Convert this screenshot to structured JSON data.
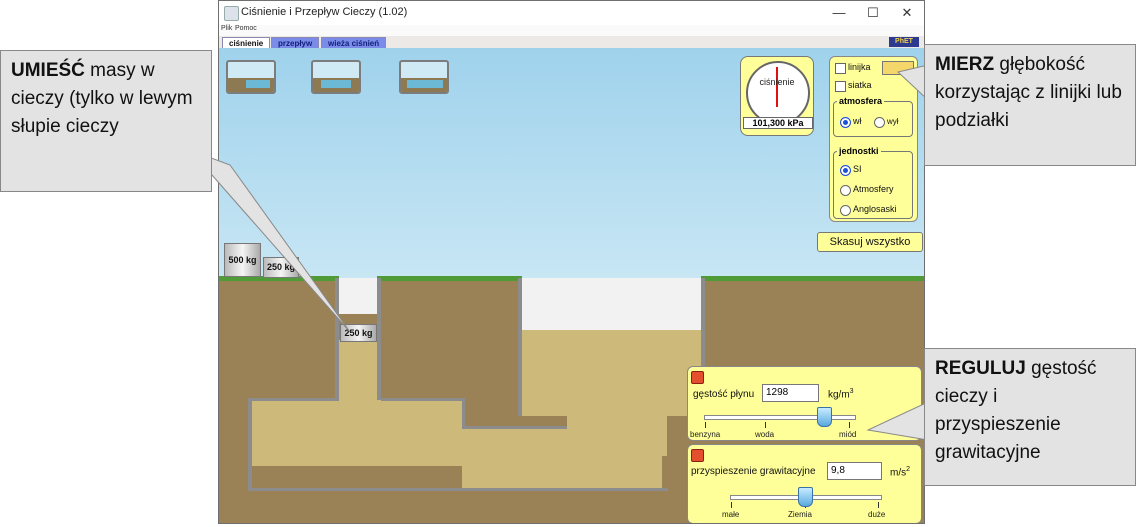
{
  "window": {
    "title": "Ciśnienie i Przepływ Cieczy (1.02)",
    "controls": {
      "minimize": "—",
      "maximize": "☐",
      "close": "✕"
    }
  },
  "menu": {
    "file": "Plik",
    "help": "Pomoc"
  },
  "tabs": [
    {
      "label": "ciśnienie",
      "active": true
    },
    {
      "label": "przepływ",
      "active": false
    },
    {
      "label": "wieża ciśnień",
      "active": false
    }
  ],
  "logo_text": "PhET",
  "gauge": {
    "label": "ciśnienie",
    "value": "101,300 kPa"
  },
  "controls": {
    "ruler_label": "linijka",
    "grid_label": "siatka",
    "atmosphere": {
      "title": "atmosfera",
      "on": "wł",
      "off": "wył",
      "selected": "wł"
    },
    "units": {
      "title": "jednostki",
      "options": [
        "SI",
        "Atmosfery",
        "Anglosaski"
      ],
      "selected": "SI"
    },
    "reset_label": "Skasuj wszystko"
  },
  "masses": [
    {
      "label": "500 kg"
    },
    {
      "label": "250 kg"
    },
    {
      "label": "250 kg"
    }
  ],
  "fluid_density": {
    "label": "gęstość płynu",
    "value": "1298",
    "unit": "kg/m",
    "unit_exp": "3",
    "ticks": [
      "benzyna",
      "woda",
      "miód"
    ],
    "slider_fraction": 0.8
  },
  "gravity": {
    "label": "przyspieszenie grawitacyjne",
    "value": "9,8",
    "unit": "m/s",
    "unit_exp": "2",
    "ticks": [
      "małe",
      "Ziemia",
      "duże"
    ],
    "slider_fraction": 0.5
  },
  "callouts": {
    "place": {
      "bold": "UMIEŚĆ",
      "rest": " masy w cieczy (tylko w lewym słupie cieczy"
    },
    "measure": {
      "bold": "MIERZ",
      "rest": " głębokość korzystając z linijki lub podziałki"
    },
    "adjust": {
      "bold": "REGULUJ",
      "rest": " gęstość cieczy i przyspieszenie grawitacyjne"
    }
  },
  "colors": {
    "panel": "#ffff9a",
    "liquid": "#cdb97a",
    "ground": "#9a8256",
    "grass": "#4f9b35",
    "sky": "#9fd2ec",
    "tab_inactive": "#7b8bea"
  }
}
